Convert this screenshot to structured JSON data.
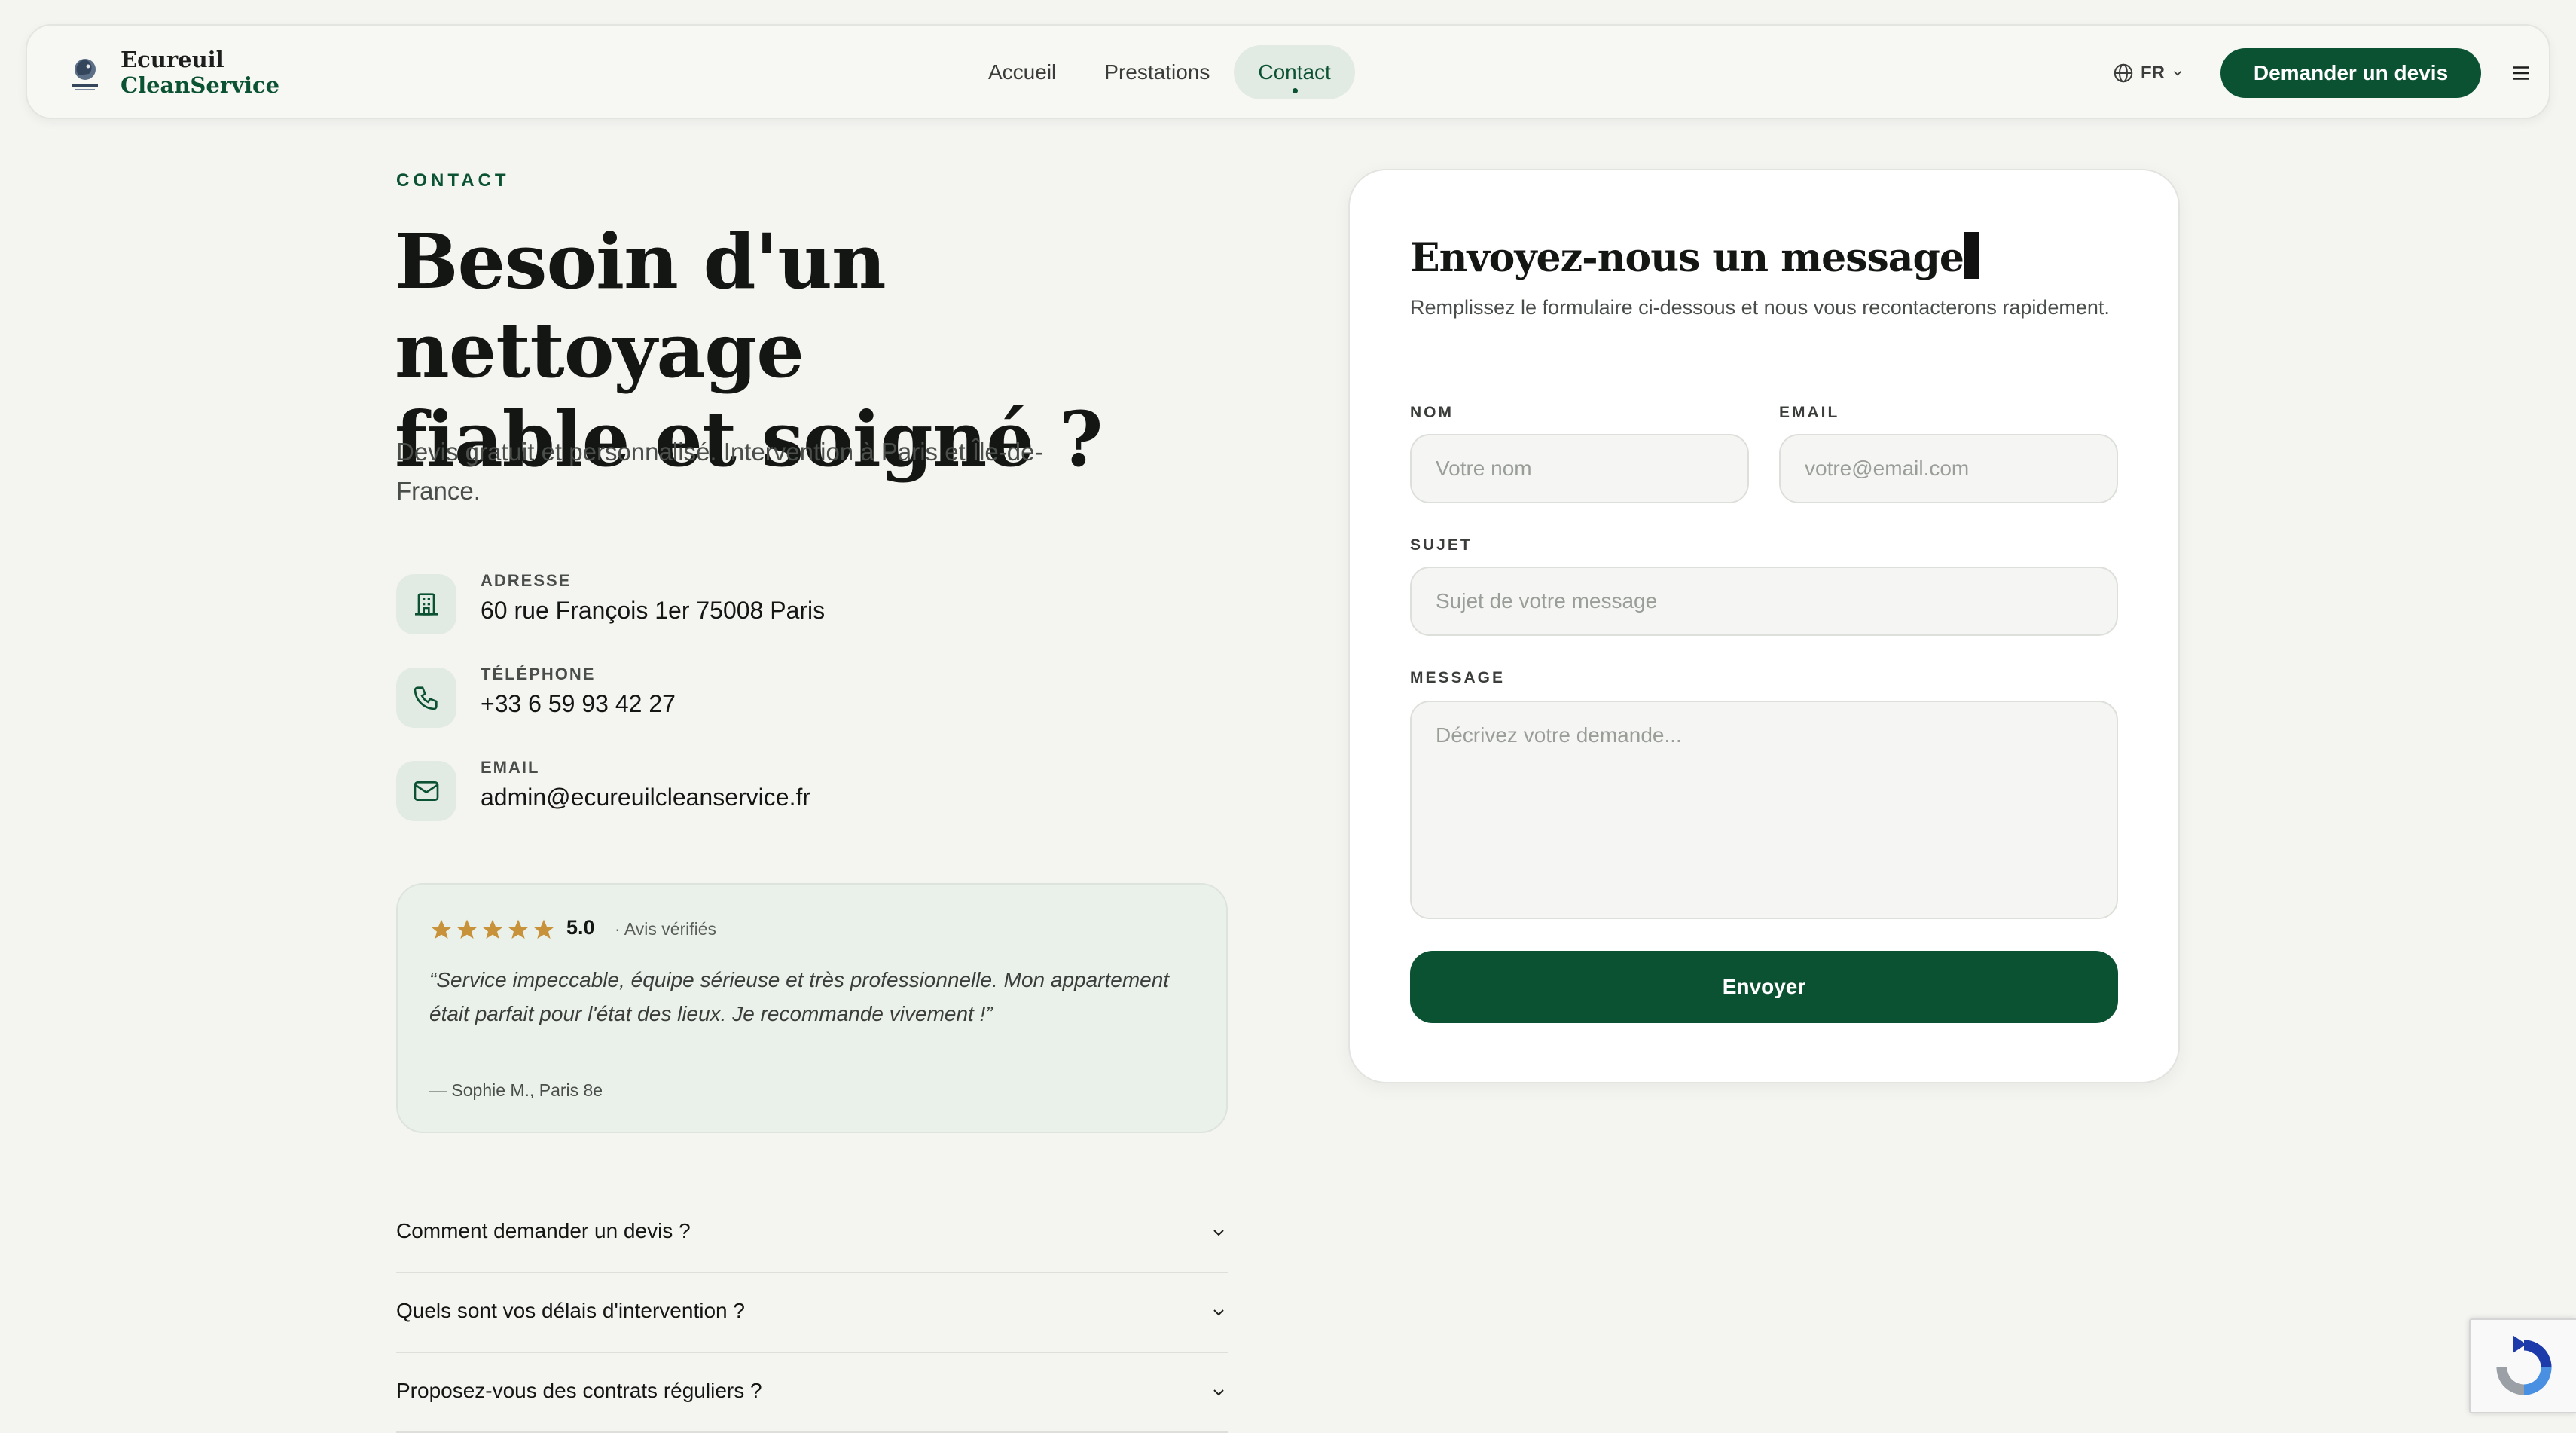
{
  "brand": {
    "line1": "Ecureuil",
    "line2": "CleanService",
    "mark_text": "ECUREUIL"
  },
  "nav": {
    "items": [
      {
        "label": "Accueil",
        "active": false
      },
      {
        "label": "Prestations",
        "active": false
      },
      {
        "label": "Contact",
        "active": true
      }
    ]
  },
  "header": {
    "language": "FR",
    "cta_label": "Demander un devis"
  },
  "hero": {
    "eyebrow": "CONTACT",
    "title_line1": "Besoin d'un nettoyage",
    "title_line2": "fiable et soigné ?",
    "subtitle": "Devis gratuit et personnalisé. Intervention à Paris et Île-de-France."
  },
  "contact": {
    "address": {
      "label": "ADRESSE",
      "value": "60 rue François 1er 75008 Paris",
      "icon": "building-icon"
    },
    "phone": {
      "label": "TÉLÉPHONE",
      "value": "+33 6 59 93 42 27",
      "icon": "phone-icon"
    },
    "email": {
      "label": "EMAIL",
      "value": "admin@ecureuilcleanservice.fr",
      "icon": "mail-icon"
    }
  },
  "review": {
    "stars": 5,
    "rating": "5.0",
    "verified": "· Avis vérifiés",
    "quote": "“Service impeccable, équipe sérieuse et très professionnelle. Mon appartement était parfait pour l'état des lieux. Je recommande vivement !”",
    "author": "— Sophie M., Paris 8e",
    "star_color": "#c8923a"
  },
  "faq": [
    {
      "question": "Comment demander un devis ?"
    },
    {
      "question": "Quels sont vos délais d'intervention ?"
    },
    {
      "question": "Proposez-vous des contrats réguliers ?"
    }
  ],
  "form": {
    "title": "Envoyez-nous un message",
    "subtitle": "Remplissez le formulaire ci-dessous et nous vous recontacterons rapidement.",
    "name": {
      "label": "NOM",
      "placeholder": "Votre nom",
      "value": ""
    },
    "email": {
      "label": "EMAIL",
      "placeholder": "votre@email.com",
      "value": ""
    },
    "subject": {
      "label": "SUJET",
      "placeholder": "Sujet de votre message",
      "value": ""
    },
    "message": {
      "label": "MESSAGE",
      "placeholder": "Décrivez votre demande...",
      "value": ""
    },
    "submit_label": "Envoyer"
  },
  "colors": {
    "brand_green": "#0b5232",
    "soft_green": "#e2ebe3",
    "background": "#f4f4f1"
  }
}
